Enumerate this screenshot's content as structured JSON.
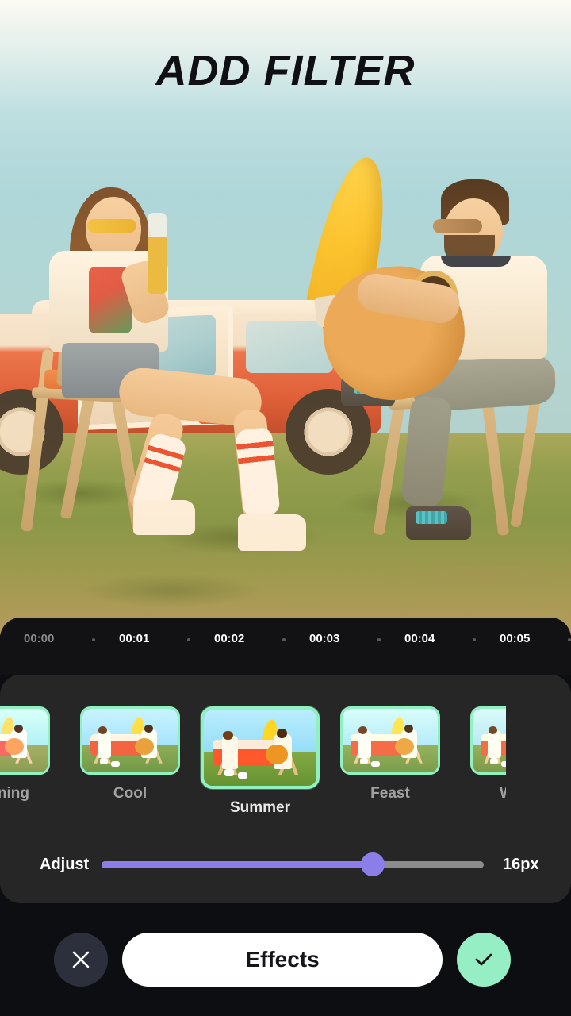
{
  "header": {
    "title": "ADD FILTER"
  },
  "preview": {
    "alt": "couple-with-guitar-and-van-photo"
  },
  "timeline": {
    "marks": [
      "00:00",
      "00:01",
      "00:02",
      "00:03",
      "00:04",
      "00:05"
    ],
    "separator": "dot"
  },
  "filters": {
    "items": [
      {
        "label": "Evening",
        "selected": false,
        "tint": "t-evening"
      },
      {
        "label": "Cool",
        "selected": false,
        "tint": "t-cool"
      },
      {
        "label": "Summer",
        "selected": true,
        "tint": "t-summer"
      },
      {
        "label": "Feast",
        "selected": false,
        "tint": "t-feast"
      },
      {
        "label": "Warm",
        "selected": false,
        "tint": "t-warm"
      }
    ],
    "border_color": "#8ff0c0"
  },
  "adjust": {
    "label": "Adjust",
    "value_label": "16px",
    "percent": 71,
    "fill_color": "#8b7ee8",
    "track_color": "#8c8c8c"
  },
  "bottom_bar": {
    "close_icon": "close-x-icon",
    "effects_label": "Effects",
    "confirm_icon": "check-icon",
    "confirm_color": "#96eec4"
  }
}
